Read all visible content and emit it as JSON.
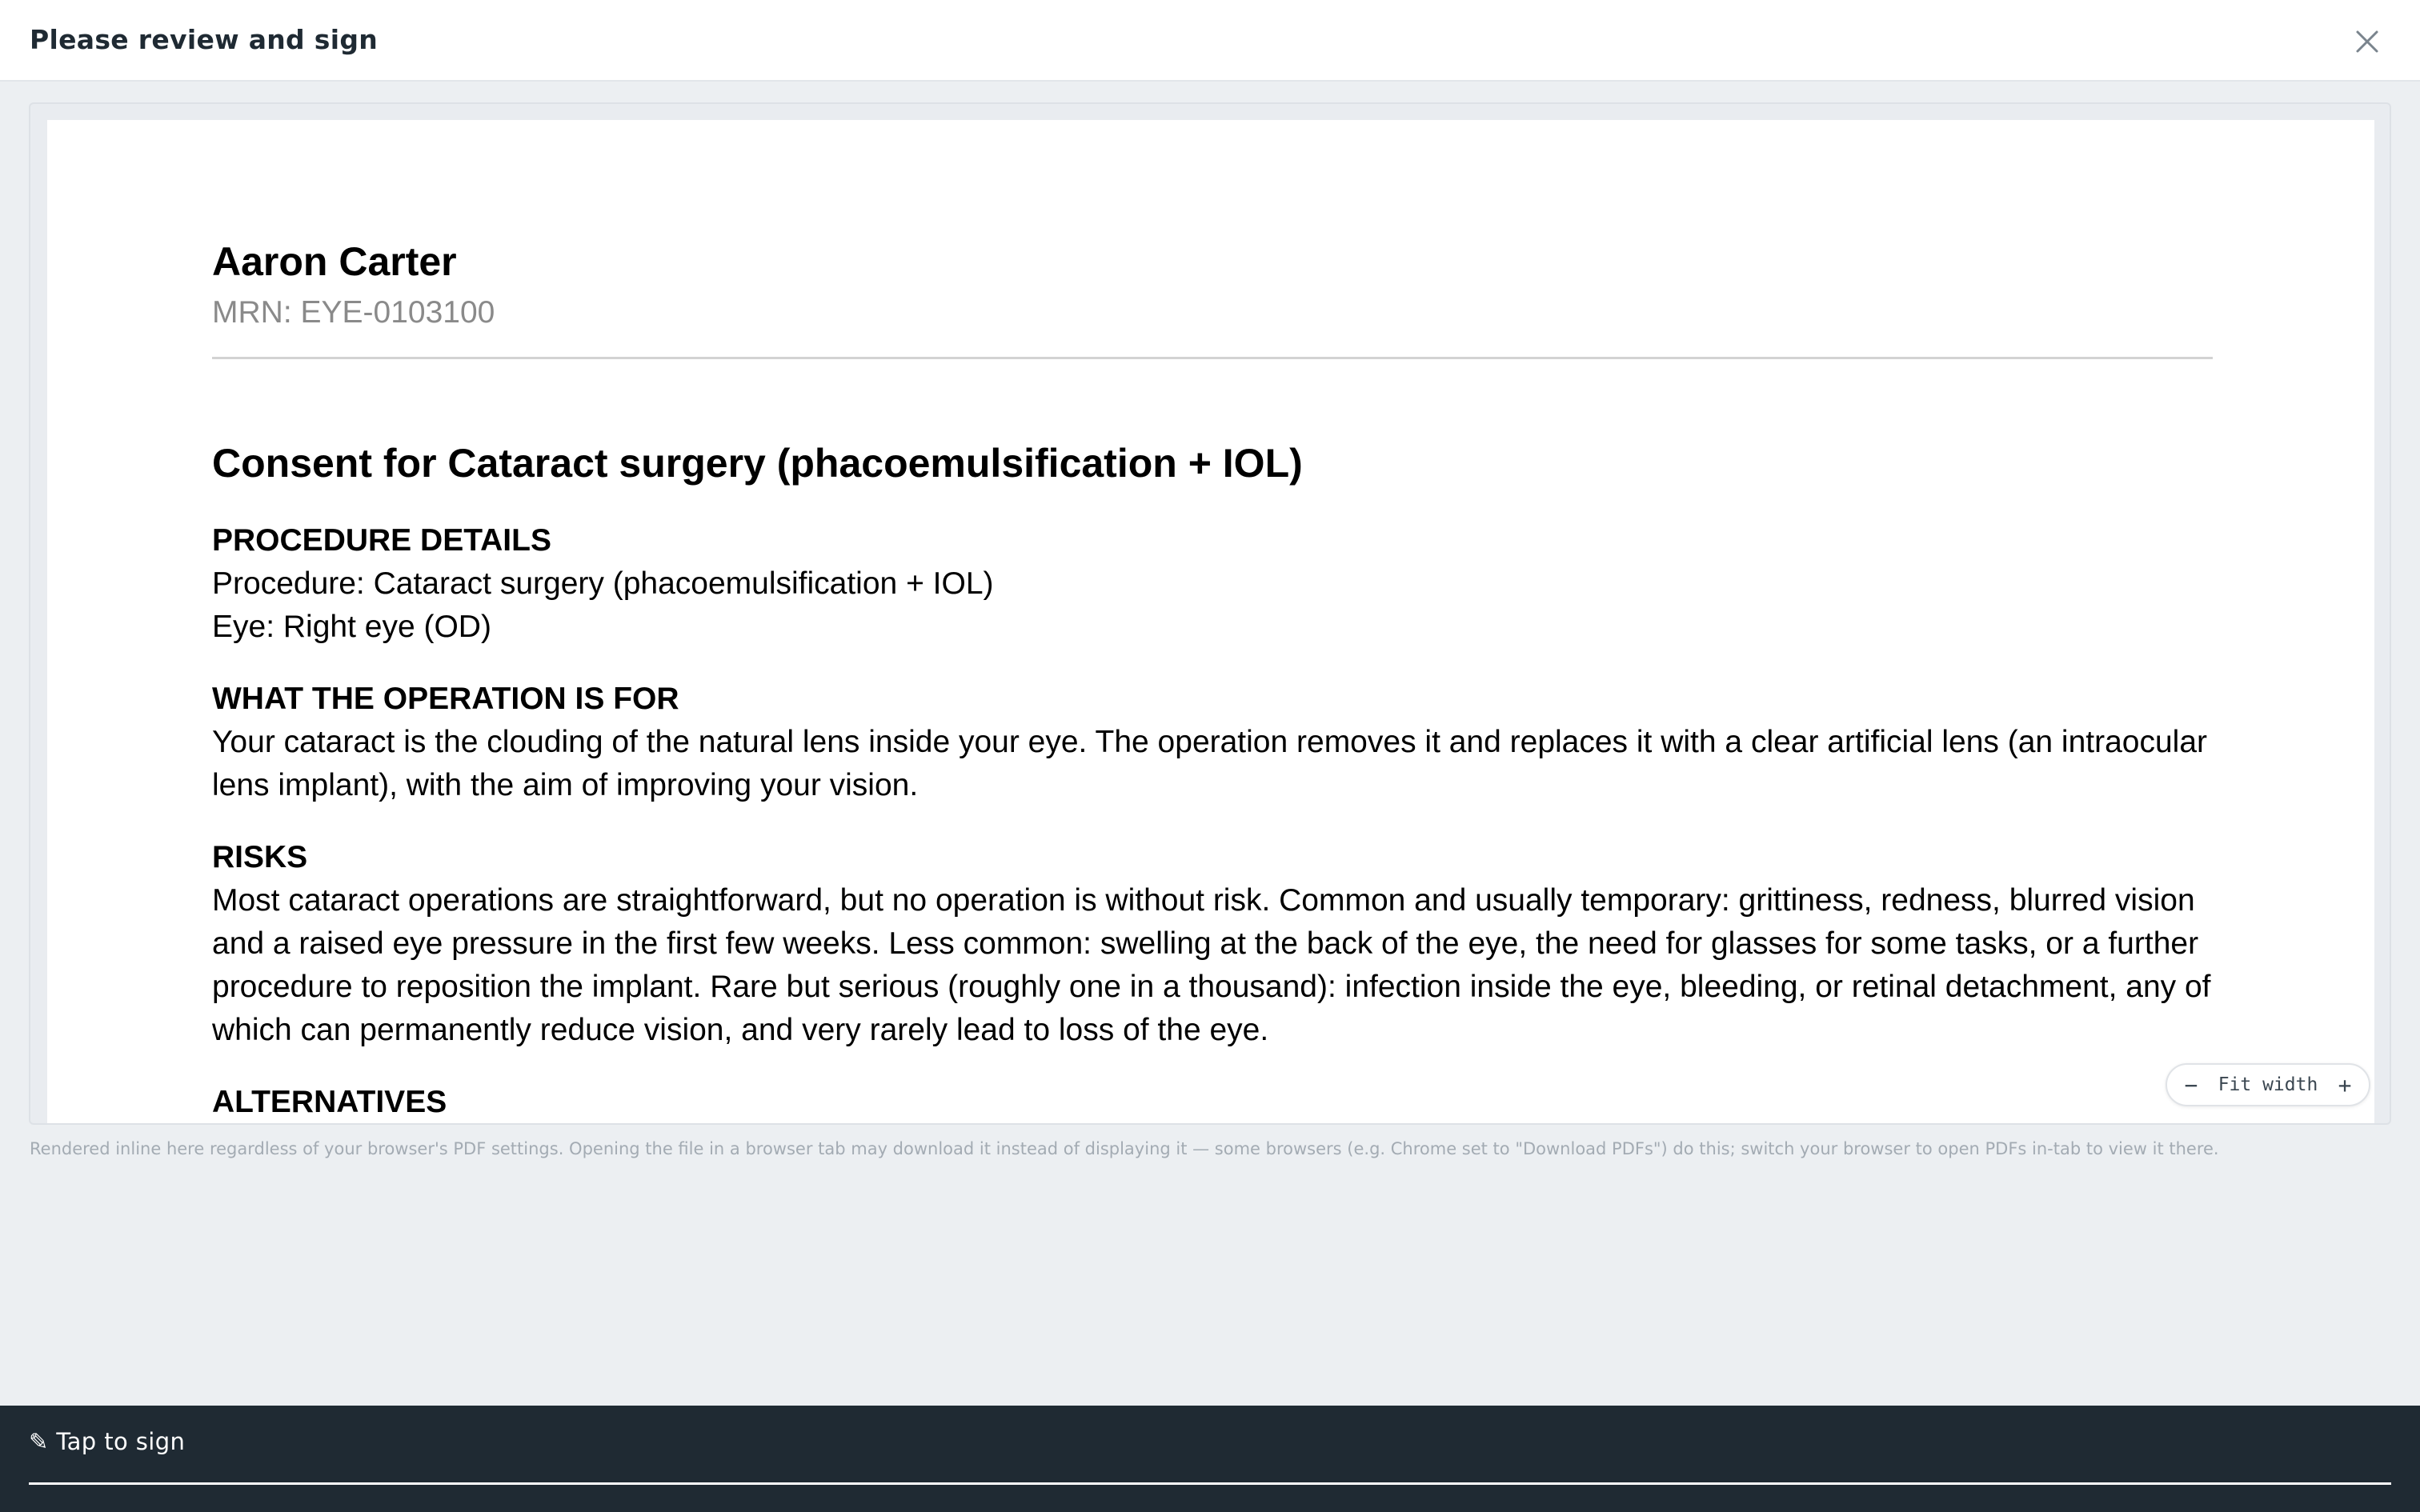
{
  "header": {
    "title": "Please review and sign",
    "close_icon": "close-icon"
  },
  "document": {
    "patient_name": "Aaron Carter",
    "mrn": "MRN: EYE-0103100",
    "title": "Consent for Cataract surgery (phacoemulsification + IOL)",
    "sections": [
      {
        "heading": "PROCEDURE DETAILS",
        "lines": [
          "Procedure: Cataract surgery (phacoemulsification + IOL)",
          "Eye: Right eye (OD)"
        ]
      },
      {
        "heading": "WHAT THE OPERATION IS FOR",
        "lines": [
          "Your cataract is the clouding of the natural lens inside your eye. The operation removes it and replaces it with a clear artificial lens (an intraocular lens implant), with the aim of improving your vision."
        ]
      },
      {
        "heading": "RISKS",
        "lines": [
          "Most cataract operations are straightforward, but no operation is without risk. Common and usually temporary: grittiness, redness, blurred vision and a raised eye pressure in the first few weeks. Less common: swelling at the back of the eye, the need for glasses for some tasks, or a further procedure to reposition the implant. Rare but serious (roughly one in a thousand): infection inside the eye, bleeding, or retinal detachment, any of which can permanently reduce vision, and very rarely lead to loss of the eye."
        ]
      },
      {
        "heading": "ALTERNATIVES",
        "lines": []
      }
    ]
  },
  "zoom": {
    "minus": "−",
    "label": "Fit width",
    "plus": "+"
  },
  "note": "Rendered inline here regardless of your browser's PDF settings. Opening the file in a browser tab may download it instead of displaying it — some browsers (e.g. Chrome set to \"Download PDFs\") do this; switch your browser to open PDFs in-tab to view it there.",
  "footer": {
    "sign_label": "✎ Tap to sign"
  },
  "colors": {
    "footer_bg": "#1f2a33",
    "page_bg": "#eceff2"
  }
}
